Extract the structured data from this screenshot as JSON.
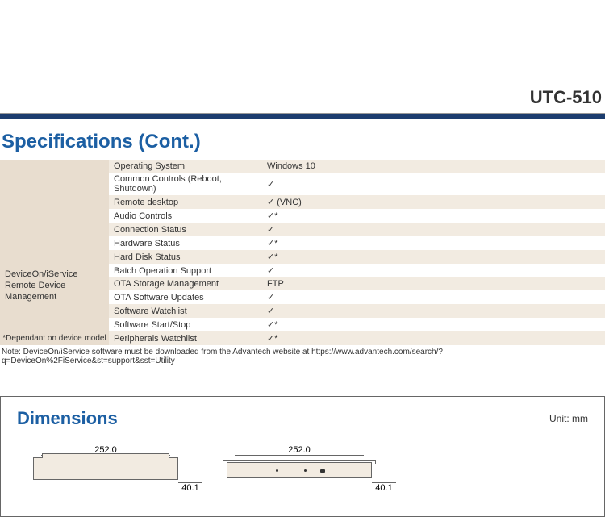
{
  "product_title": "UTC-510",
  "sections": {
    "specs_heading": "Specifications (Cont.)",
    "dimensions_heading": "Dimensions",
    "dimensions_unit": "Unit: mm"
  },
  "spec_group": {
    "title_line1": "DeviceOn/iService",
    "title_line2": "Remote Device Management",
    "footnote": "*Dependant on device model"
  },
  "spec_rows": [
    {
      "label": "Operating System",
      "value": "Windows 10"
    },
    {
      "label": "Common Controls (Reboot, Shutdown)",
      "value": "✓"
    },
    {
      "label": "Remote desktop",
      "value": "✓ (VNC)"
    },
    {
      "label": "Audio Controls",
      "value": "✓*"
    },
    {
      "label": "Connection Status",
      "value": "✓"
    },
    {
      "label": "Hardware Status",
      "value": "✓*"
    },
    {
      "label": "Hard Disk Status",
      "value": "✓*"
    },
    {
      "label": "Batch Operation Support",
      "value": "✓"
    },
    {
      "label": "OTA Storage Management",
      "value": "FTP"
    },
    {
      "label": "OTA Software Updates",
      "value": "✓"
    },
    {
      "label": "Software Watchlist",
      "value": "✓"
    },
    {
      "label": "Software Start/Stop",
      "value": "✓*"
    },
    {
      "label": "Peripherals Watchlist",
      "value": "✓*"
    }
  ],
  "table_note": "Note: DeviceOn/iService software must be downloaded from the Advantech website at https://www.advantech.com/search/?q=DeviceOn%2FiService&st=support&sst=Utility",
  "dimensions": {
    "width_label": "252.0",
    "depth_label": "40.1"
  }
}
